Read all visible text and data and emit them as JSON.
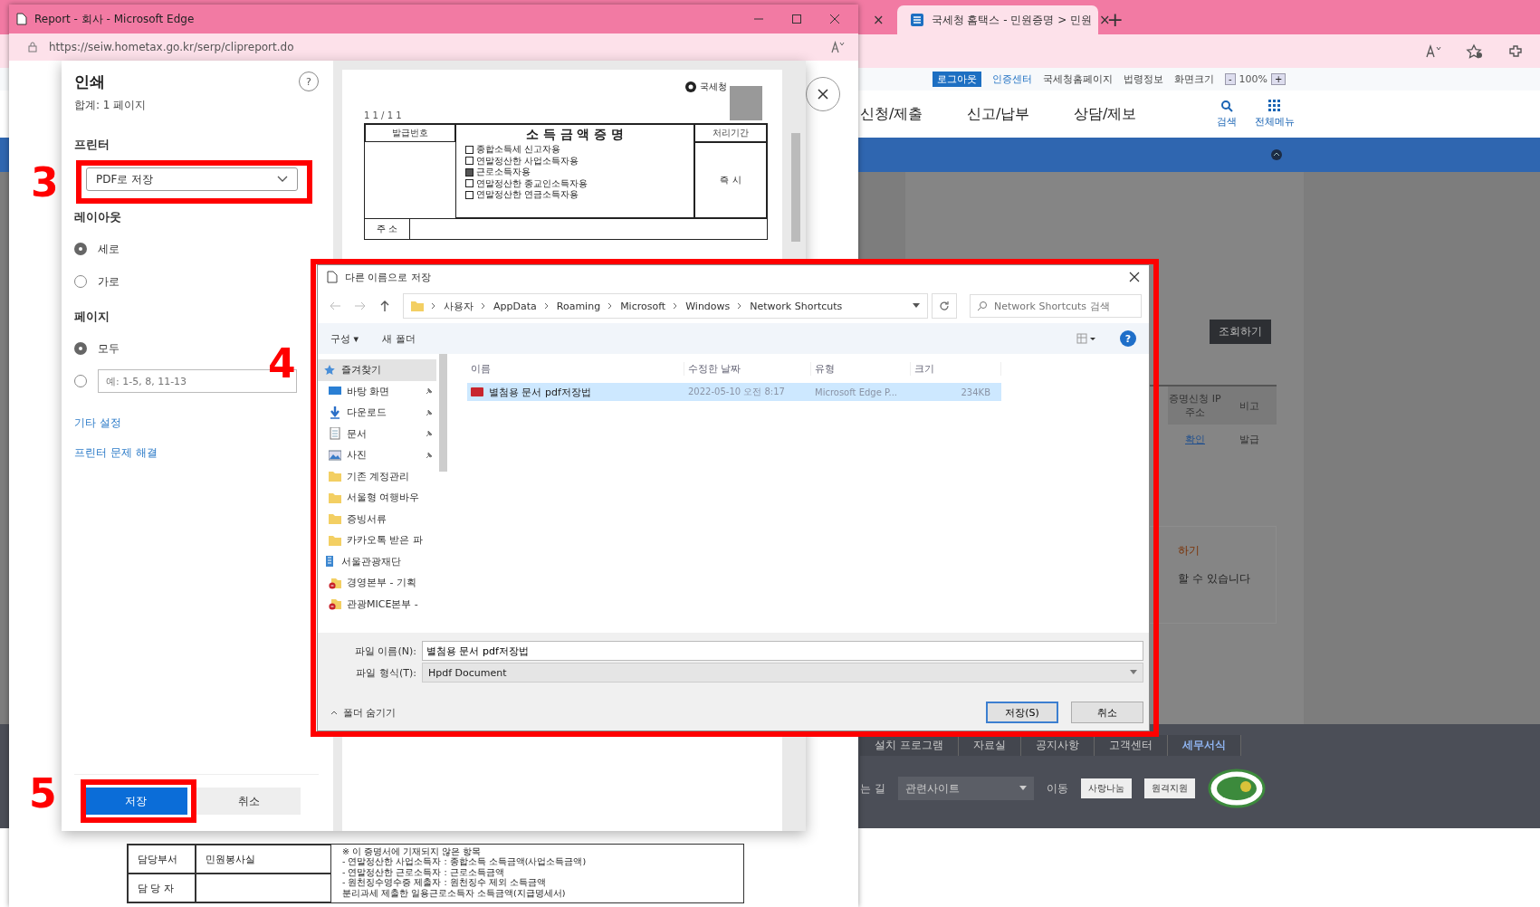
{
  "browser": {
    "tabs": [
      {
        "close": "×",
        "selected": false
      },
      {
        "title": "국세청 홈택스 - 민원증명 > 민원",
        "close": "×",
        "selected": true
      }
    ],
    "new_tab": "+"
  },
  "site": {
    "util_links": [
      {
        "label": "로그아웃",
        "kind": "badge"
      },
      {
        "label": "인증센터",
        "kind": "link"
      },
      {
        "label": "국세청홈페이지",
        "kind": "text"
      },
      {
        "label": "법령정보",
        "kind": "text"
      },
      {
        "label": "화면크기",
        "kind": "text"
      }
    ],
    "zoom": {
      "minus": "-",
      "value": "100%",
      "plus": "+"
    },
    "nav": [
      "신청/제출",
      "신고/납부",
      "상담/제보"
    ],
    "nav_tools": [
      {
        "label": "검색",
        "kind": "search"
      },
      {
        "label": "전체메뉴",
        "kind": "grid"
      }
    ],
    "query_button": "조회하기",
    "table": {
      "columns": [
        "증명신청 IP주소",
        "비고"
      ],
      "rows": [
        [
          "확인",
          "발급"
        ]
      ]
    },
    "notice": {
      "highlight": "하기",
      "text": "할 수 있습니다"
    },
    "footer": {
      "links": [
        {
          "label": "설치 프로그램",
          "selected": false
        },
        {
          "label": "자료실",
          "selected": false
        },
        {
          "label": "공지사항",
          "selected": false
        },
        {
          "label": "고객센터",
          "selected": false
        },
        {
          "label": "세무서식",
          "selected": true
        }
      ],
      "directions": "는 길",
      "related": "관련사이트",
      "go": "이동",
      "banners": [
        "사랑나눔",
        "원격지원"
      ]
    }
  },
  "popup": {
    "title": "Report - 회사 - Microsoft Edge",
    "url": "https://seiw.hometax.go.kr/serp/clipreport.do",
    "document": {
      "page_no": "1 1 / 1 1",
      "agency": "국세청",
      "title": "소 득 금 액 증 명",
      "issue_no": "발급번호",
      "period": "처리기간",
      "period_value": "즉 시",
      "purposes": [
        {
          "label": "종합소득세 신고자용",
          "checked": false
        },
        {
          "label": "연말정산한 사업소득자용",
          "checked": false
        },
        {
          "label": "근로소득자용",
          "checked": true
        },
        {
          "label": "연말정산한 종교인소득자용",
          "checked": false
        },
        {
          "label": "연말정산한 연금소득자용",
          "checked": false
        }
      ],
      "address": "주 소",
      "footer_rows": [
        {
          "label": "담당부서",
          "value": "민원봉사실"
        },
        {
          "label": "담 당 자"
        }
      ],
      "notes": [
        "※ 이 증명서에 기재되지 않은 항목",
        "- 연말정산한 사업소득자 : 종합소득 소득금액(사업소득금액)",
        "- 연말정산한 근로소득자 : 근로소득금액",
        "- 원천징수영수증 제출자 : 원천징수 제외 소득금액",
        "분리과세 제출한 일용근로소득자 소득금액(지급명세서)"
      ]
    }
  },
  "print": {
    "title": "인쇄",
    "total": "합계: 1 페이지",
    "help": "?",
    "printer_label": "프린터",
    "printer": "PDF로 저장",
    "layout_label": "레이아웃",
    "layout": [
      {
        "label": "세로",
        "selected": true
      },
      {
        "label": "가로",
        "selected": false
      }
    ],
    "pages_label": "페이지",
    "pages": [
      {
        "label": "모두",
        "selected": true
      },
      {
        "placeholder": "예: 1-5, 8, 11-13",
        "selected": false
      }
    ],
    "more": "기타 설정",
    "troubleshoot": "프린터 문제 해결",
    "save": "저장",
    "cancel": "취소"
  },
  "save_dialog": {
    "title": "다른 이름으로 저장",
    "path": [
      "사용자",
      "AppData",
      "Roaming",
      "Microsoft",
      "Windows",
      "Network Shortcuts"
    ],
    "search_placeholder": "Network Shortcuts 검색",
    "organize": "구성 ▾",
    "new_folder": "새 폴더",
    "help": "?",
    "tree": [
      {
        "label": "즐겨찾기",
        "kind": "star",
        "pinned": false,
        "selected": true
      },
      {
        "label": "바탕 화면",
        "kind": "desktop",
        "pinned": true,
        "selected": false
      },
      {
        "label": "다운로드",
        "kind": "download",
        "pinned": true,
        "selected": false
      },
      {
        "label": "문서",
        "kind": "document",
        "pinned": true,
        "selected": false
      },
      {
        "label": "사진",
        "kind": "picture",
        "pinned": true,
        "selected": false
      },
      {
        "label": "기존 계정관리",
        "kind": "folder",
        "pinned": false,
        "selected": false
      },
      {
        "label": "서울형 여행바우",
        "kind": "folder",
        "pinned": false,
        "selected": false
      },
      {
        "label": "증빙서류",
        "kind": "folder",
        "pinned": false,
        "selected": false
      },
      {
        "label": "카카오톡 받은 파",
        "kind": "folder",
        "pinned": false,
        "selected": false
      },
      {
        "label": "서울관광재단",
        "kind": "cloud",
        "pinned": false,
        "selected": false
      },
      {
        "label": "경영본부 - 기획",
        "kind": "sync_error",
        "pinned": false,
        "selected": false
      },
      {
        "label": "관광MICE본부 -",
        "kind": "sync_error",
        "pinned": false,
        "selected": false
      }
    ],
    "columns": [
      "이름",
      "수정한 날짜",
      "유형",
      "크기"
    ],
    "files": [
      {
        "name": "별첨용 문서 pdf저장법",
        "date": "2022-05-10 오전 8:17",
        "type": "Microsoft Edge P...",
        "size": "234KB",
        "selected": true
      }
    ],
    "filename_label": "파일 이름(N):",
    "filename": "별첨용 문서 pdf저장법",
    "type_label": "파일 형식(T):",
    "filetype": "Hpdf Document",
    "hide_folders": "폴더 숨기기",
    "save": "저장(S)",
    "cancel": "취소"
  },
  "annotations": [
    {
      "label": "3",
      "kind": "printer"
    },
    {
      "label": "4",
      "kind": "dialog"
    },
    {
      "label": "5",
      "kind": "save"
    }
  ]
}
